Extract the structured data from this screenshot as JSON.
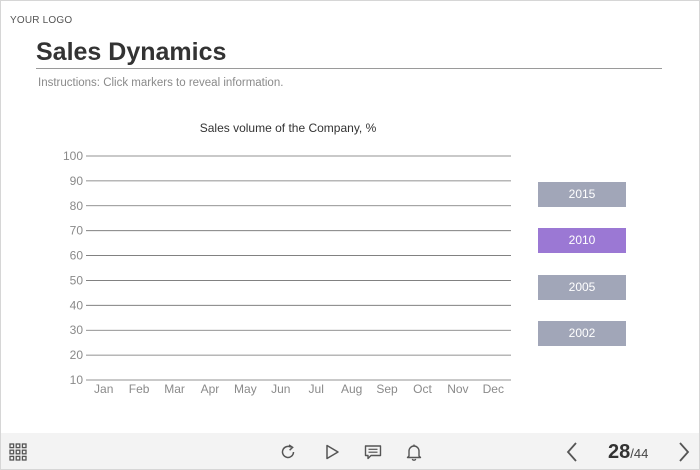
{
  "header": {
    "logo_text": "YOUR LOGO",
    "title": "Sales Dynamics",
    "instructions": "Instructions: Click markers to reveal information."
  },
  "chart_data": {
    "type": "line",
    "title": "Sales volume of the Company, %",
    "categories": [
      "Jan",
      "Feb",
      "Mar",
      "Apr",
      "May",
      "Jun",
      "Jul",
      "Aug",
      "Sep",
      "Oct",
      "Nov",
      "Dec"
    ],
    "yticks": [
      100,
      90,
      80,
      70,
      60,
      50,
      40,
      30,
      20,
      10
    ],
    "ylim": [
      10,
      100
    ],
    "grid": true,
    "series": []
  },
  "year_buttons": [
    {
      "label": "2015",
      "active": false
    },
    {
      "label": "2010",
      "active": true
    },
    {
      "label": "2005",
      "active": false
    },
    {
      "label": "2002",
      "active": false
    }
  ],
  "colors": {
    "button_default": "#a1a6b8",
    "button_active": "#9b78d4",
    "grid_line": "#6f6f6f",
    "tick_label": "#8a8a8a"
  },
  "navigation": {
    "current_page": "28",
    "separator": "/",
    "total_pages": "44",
    "icons": [
      "menu-grid-icon",
      "replay-icon",
      "play-icon",
      "comment-icon",
      "bell-icon",
      "prev-arrow-icon",
      "next-arrow-icon"
    ]
  }
}
